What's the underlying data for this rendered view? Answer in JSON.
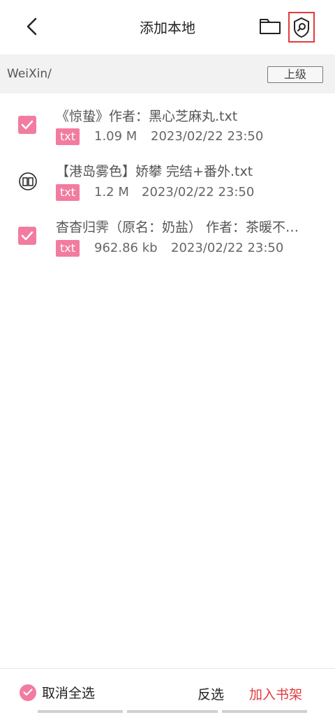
{
  "header": {
    "title": "添加本地",
    "back_icon": "chevron-left-icon",
    "folder_icon": "folder-icon",
    "scan_icon": "shield-search-icon",
    "highlight_color": "#e23b3b"
  },
  "path": {
    "current": "WeiXin/",
    "up_label": "上级"
  },
  "files": [
    {
      "name": "《惊蛰》作者：黑心芝麻丸.txt",
      "type": "txt",
      "size": "1.09 M",
      "date": "2023/02/22 23:50",
      "state": "checked"
    },
    {
      "name": "【港岛雾色】娇攀  完结+番外.txt",
      "type": "txt",
      "size": "1.2 M",
      "date": "2023/02/22 23:50",
      "state": "in-shelf"
    },
    {
      "name": "杳杳归霁（原名：奶盐） 作者：茶暖不…",
      "type": "txt",
      "size": "962.86 kb",
      "date": "2023/02/22 23:50",
      "state": "checked"
    }
  ],
  "footer": {
    "cancel_all": "取消全选",
    "invert": "反选",
    "add_to_shelf": "加入书架"
  },
  "colors": {
    "accent_pink": "#f27ca0",
    "accent_red": "#e23b3b"
  }
}
